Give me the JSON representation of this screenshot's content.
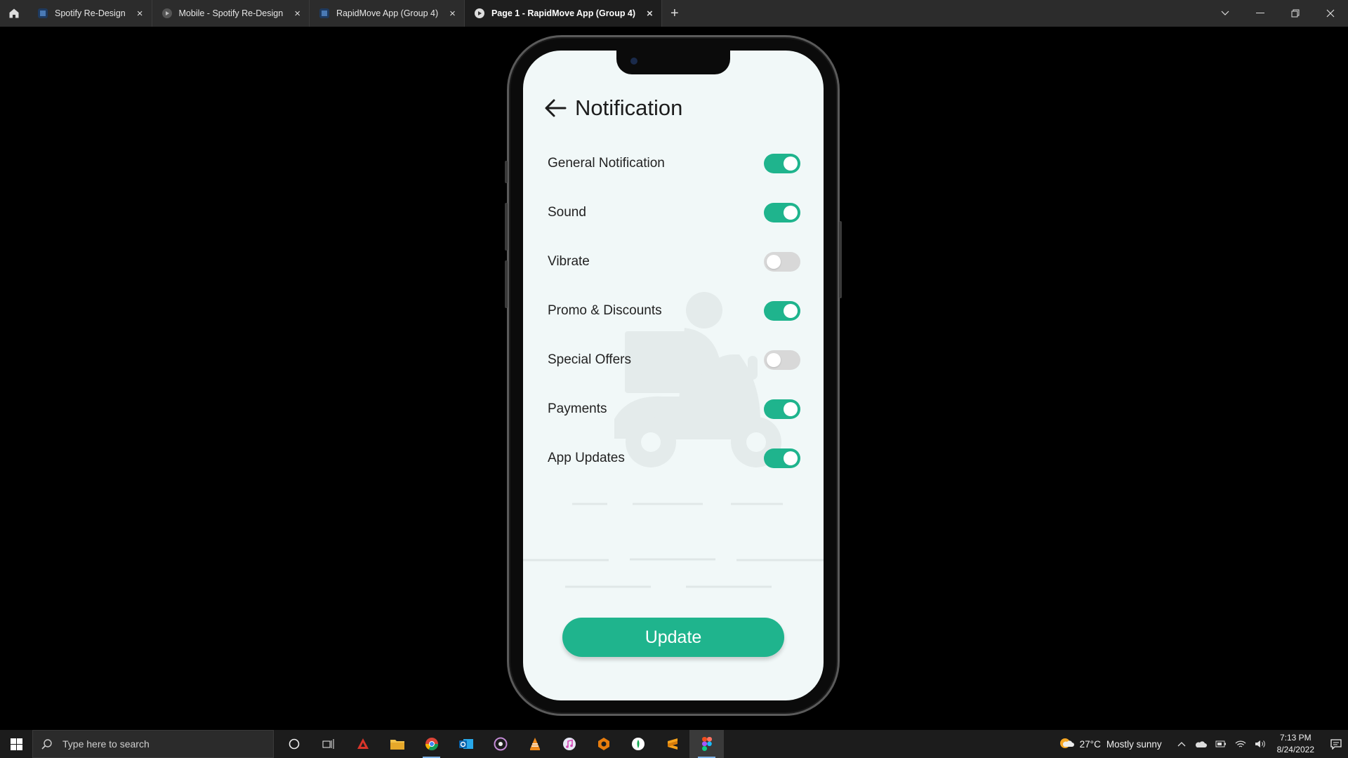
{
  "browser": {
    "tabs": [
      {
        "label": "Spotify Re-Design",
        "icon": "figma-file-icon",
        "active": false
      },
      {
        "label": "Mobile - Spotify Re-Design",
        "icon": "prototype-play-icon",
        "active": false
      },
      {
        "label": "RapidMove App (Group 4)",
        "icon": "figma-file-icon",
        "active": false
      },
      {
        "label": "Page 1 - RapidMove App (Group 4)",
        "icon": "prototype-play-icon",
        "active": true
      }
    ],
    "close_glyph": "×",
    "add_glyph": "+"
  },
  "app": {
    "title": "Notification",
    "settings": [
      {
        "label": "General Notification",
        "enabled": true
      },
      {
        "label": "Sound",
        "enabled": true
      },
      {
        "label": "Vibrate",
        "enabled": false
      },
      {
        "label": "Promo & Discounts",
        "enabled": true
      },
      {
        "label": "Special Offers",
        "enabled": false
      },
      {
        "label": "Payments",
        "enabled": true
      },
      {
        "label": "App Updates",
        "enabled": true
      }
    ],
    "update_label": "Update",
    "colors": {
      "accent": "#1fb48d",
      "toggle_off": "#d8d8d8",
      "screen_bg": "#f1f8f8"
    }
  },
  "taskbar": {
    "search_placeholder": "Type here to search",
    "weather_temp": "27°C",
    "weather_text": "Mostly sunny",
    "time": "7:13 PM",
    "date": "8/24/2022"
  }
}
